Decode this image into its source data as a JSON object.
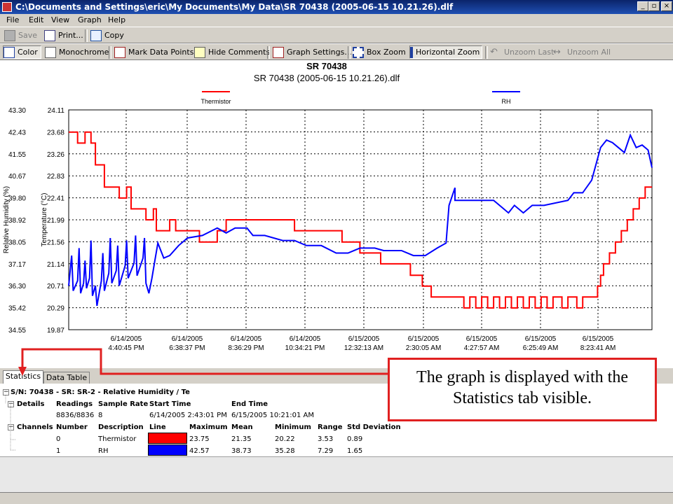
{
  "window": {
    "title": "C:\\Documents and Settings\\eric\\My Documents\\My Data\\SR 70438 (2005-06-15 10.21.26).dlf",
    "btn_min": "_",
    "btn_max": "▫",
    "btn_close": "×"
  },
  "menu": {
    "file": "File",
    "edit": "Edit",
    "view": "View",
    "graph": "Graph",
    "help": "Help"
  },
  "toolbar1": {
    "save": "Save",
    "print": "Print...",
    "copy": "Copy"
  },
  "toolbar2": {
    "color": "Color",
    "monochrome": "Monochrome",
    "mark_points": "Mark Data Points",
    "hide_comments": "Hide Comments",
    "graph_settings": "Graph Settings...",
    "box_zoom": "Box Zoom",
    "horizontal_zoom": "Horizontal Zoom",
    "unzoom_last": "Unzoom Last",
    "unzoom_all": "Unzoom All"
  },
  "tabs": {
    "statistics": "Statistics",
    "data_table": "Data Table"
  },
  "stats": {
    "tree_header": "S/N: 70438 - SR: SR-2 - Relative Humidity / Te",
    "details": {
      "label": "Details",
      "readings_h": "Readings",
      "sample_rate_h": "Sample Rate",
      "start_time_h": "Start Time",
      "end_time_h": "End Time",
      "readings": "8836/8836",
      "sample_rate": "8",
      "start_time": "6/14/2005 2:43:01 PM",
      "end_time": "6/15/2005 10:21:01 AM"
    },
    "channels": {
      "label": "Channels",
      "number_h": "Number",
      "description_h": "Description",
      "line_h": "Line",
      "maximum_h": "Maximum",
      "mean_h": "Mean",
      "minimum_h": "Minimum",
      "range_h": "Range",
      "std_h": "Std Deviation",
      "rows": [
        {
          "number": "0",
          "description": "Thermistor",
          "color": "#ff0000",
          "maximum": "23.75",
          "mean": "21.35",
          "minimum": "20.22",
          "range": "3.53",
          "std": "0.89"
        },
        {
          "number": "1",
          "description": "RH",
          "color": "#0000ff",
          "maximum": "42.57",
          "mean": "38.73",
          "minimum": "35.28",
          "range": "7.29",
          "std": "1.65"
        }
      ]
    }
  },
  "callout": {
    "text": "The graph is displayed with the Statistics tab visible."
  },
  "chart_data": {
    "type": "line",
    "title": "SR 70438",
    "subtitle": "SR 70438 (2005-06-15 10.21.26).dlf",
    "ylabel_left": "Relative Humidity (%)",
    "ylabel_right": "Temperature (°C)",
    "rh_ticks": [
      "43.30",
      "42.43",
      "41.55",
      "40.67",
      "39.80",
      "38.92",
      "38.05",
      "37.17",
      "36.30",
      "35.42",
      "34.55"
    ],
    "temp_ticks": [
      "24.11",
      "23.68",
      "23.26",
      "22.83",
      "22.41",
      "21.99",
      "21.56",
      "21.14",
      "20.71",
      "20.29",
      "19.87"
    ],
    "x_ticks": [
      [
        "6/14/2005",
        "4:40:45 PM"
      ],
      [
        "6/14/2005",
        "6:38:37 PM"
      ],
      [
        "6/14/2005",
        "8:36:29 PM"
      ],
      [
        "6/14/2005",
        "10:34:21 PM"
      ],
      [
        "6/15/2005",
        "12:32:13 AM"
      ],
      [
        "6/15/2005",
        "2:30:05 AM"
      ],
      [
        "6/15/2005",
        "4:27:57 AM"
      ],
      [
        "6/15/2005",
        "6:25:49 AM"
      ],
      [
        "6/15/2005",
        "8:23:41 AM"
      ]
    ],
    "rh_ylim": [
      34.55,
      43.3
    ],
    "temp_ylim": [
      19.87,
      24.11
    ],
    "x_hours_range": [
      0,
      19.63
    ],
    "grid": true,
    "legend_position": "top",
    "series": [
      {
        "name": "Thermistor",
        "axis": "temp",
        "color": "#ff0000",
        "points": [
          [
            0,
            23.68
          ],
          [
            0.3,
            23.68
          ],
          [
            0.3,
            23.47
          ],
          [
            0.55,
            23.47
          ],
          [
            0.55,
            23.68
          ],
          [
            0.75,
            23.68
          ],
          [
            0.75,
            23.47
          ],
          [
            0.9,
            23.47
          ],
          [
            0.9,
            23.05
          ],
          [
            1.2,
            23.05
          ],
          [
            1.2,
            22.62
          ],
          [
            1.7,
            22.62
          ],
          [
            1.7,
            22.41
          ],
          [
            1.95,
            22.41
          ],
          [
            1.95,
            22.62
          ],
          [
            2.1,
            22.62
          ],
          [
            2.1,
            22.2
          ],
          [
            2.6,
            22.2
          ],
          [
            2.6,
            21.99
          ],
          [
            2.85,
            21.99
          ],
          [
            2.85,
            22.2
          ],
          [
            2.95,
            22.2
          ],
          [
            2.95,
            21.78
          ],
          [
            3.4,
            21.78
          ],
          [
            3.4,
            21.99
          ],
          [
            3.6,
            21.99
          ],
          [
            3.6,
            21.78
          ],
          [
            4.4,
            21.78
          ],
          [
            4.4,
            21.56
          ],
          [
            5.0,
            21.56
          ],
          [
            5.0,
            21.78
          ],
          [
            5.3,
            21.78
          ],
          [
            5.3,
            21.99
          ],
          [
            7.6,
            21.99
          ],
          [
            7.6,
            21.78
          ],
          [
            9.2,
            21.78
          ],
          [
            9.2,
            21.56
          ],
          [
            9.8,
            21.56
          ],
          [
            9.8,
            21.35
          ],
          [
            10.5,
            21.35
          ],
          [
            10.5,
            21.14
          ],
          [
            11.5,
            21.14
          ],
          [
            11.5,
            20.92
          ],
          [
            11.9,
            20.92
          ],
          [
            11.9,
            20.71
          ],
          [
            12.2,
            20.71
          ],
          [
            12.2,
            20.5
          ],
          [
            13.3,
            20.5
          ],
          [
            13.3,
            20.29
          ],
          [
            13.5,
            20.29
          ],
          [
            13.5,
            20.5
          ],
          [
            13.7,
            20.5
          ],
          [
            13.7,
            20.29
          ],
          [
            13.9,
            20.29
          ],
          [
            13.9,
            20.5
          ],
          [
            14.1,
            20.5
          ],
          [
            14.1,
            20.29
          ],
          [
            14.3,
            20.29
          ],
          [
            14.3,
            20.5
          ],
          [
            14.5,
            20.5
          ],
          [
            14.5,
            20.29
          ],
          [
            14.7,
            20.29
          ],
          [
            14.7,
            20.5
          ],
          [
            14.9,
            20.5
          ],
          [
            14.9,
            20.29
          ],
          [
            15.1,
            20.29
          ],
          [
            15.1,
            20.5
          ],
          [
            15.3,
            20.5
          ],
          [
            15.3,
            20.29
          ],
          [
            15.5,
            20.29
          ],
          [
            15.5,
            20.5
          ],
          [
            15.7,
            20.5
          ],
          [
            15.7,
            20.29
          ],
          [
            15.9,
            20.29
          ],
          [
            15.9,
            20.5
          ],
          [
            16.1,
            20.5
          ],
          [
            16.1,
            20.29
          ],
          [
            16.3,
            20.29
          ],
          [
            16.3,
            20.5
          ],
          [
            16.6,
            20.5
          ],
          [
            16.6,
            20.29
          ],
          [
            16.8,
            20.29
          ],
          [
            16.8,
            20.5
          ],
          [
            17.1,
            20.5
          ],
          [
            17.1,
            20.29
          ],
          [
            17.3,
            20.29
          ],
          [
            17.3,
            20.5
          ],
          [
            17.8,
            20.5
          ],
          [
            17.8,
            20.71
          ],
          [
            17.9,
            20.71
          ],
          [
            17.9,
            20.92
          ],
          [
            18.0,
            20.92
          ],
          [
            18.0,
            21.14
          ],
          [
            18.2,
            21.14
          ],
          [
            18.2,
            21.35
          ],
          [
            18.4,
            21.35
          ],
          [
            18.4,
            21.56
          ],
          [
            18.6,
            21.56
          ],
          [
            18.6,
            21.78
          ],
          [
            18.8,
            21.78
          ],
          [
            18.8,
            21.99
          ],
          [
            19.0,
            21.99
          ],
          [
            19.0,
            22.2
          ],
          [
            19.2,
            22.2
          ],
          [
            19.2,
            22.41
          ],
          [
            19.4,
            22.41
          ],
          [
            19.4,
            22.62
          ],
          [
            19.63,
            22.62
          ]
        ]
      },
      {
        "name": "RH",
        "axis": "rh",
        "color": "#0000ff",
        "points": [
          [
            0,
            36.3
          ],
          [
            0.1,
            37.5
          ],
          [
            0.15,
            36.1
          ],
          [
            0.3,
            36.5
          ],
          [
            0.35,
            37.8
          ],
          [
            0.4,
            36.0
          ],
          [
            0.5,
            36.4
          ],
          [
            0.55,
            37.3
          ],
          [
            0.6,
            36.2
          ],
          [
            0.7,
            36.6
          ],
          [
            0.75,
            38.1
          ],
          [
            0.8,
            35.9
          ],
          [
            0.9,
            36.3
          ],
          [
            0.95,
            35.5
          ],
          [
            1.1,
            36.5
          ],
          [
            1.15,
            37.6
          ],
          [
            1.2,
            36.1
          ],
          [
            1.35,
            36.8
          ],
          [
            1.4,
            38.2
          ],
          [
            1.45,
            36.4
          ],
          [
            1.6,
            36.9
          ],
          [
            1.65,
            37.9
          ],
          [
            1.7,
            36.3
          ],
          [
            1.9,
            37.1
          ],
          [
            1.95,
            38.1
          ],
          [
            2.0,
            36.6
          ],
          [
            2.2,
            37.2
          ],
          [
            2.25,
            38.3
          ],
          [
            2.3,
            36.7
          ],
          [
            2.5,
            37.4
          ],
          [
            2.55,
            38.2
          ],
          [
            2.6,
            36.4
          ],
          [
            2.7,
            36.0
          ],
          [
            2.8,
            36.6
          ],
          [
            2.9,
            37.3
          ],
          [
            3.0,
            38.0
          ],
          [
            3.2,
            37.4
          ],
          [
            3.4,
            37.5
          ],
          [
            3.7,
            37.9
          ],
          [
            4.0,
            38.2
          ],
          [
            4.5,
            38.3
          ],
          [
            5.0,
            38.6
          ],
          [
            5.3,
            38.4
          ],
          [
            5.6,
            38.6
          ],
          [
            6.0,
            38.6
          ],
          [
            6.2,
            38.3
          ],
          [
            6.6,
            38.3
          ],
          [
            7.2,
            38.1
          ],
          [
            7.6,
            38.1
          ],
          [
            8.0,
            37.9
          ],
          [
            8.5,
            37.9
          ],
          [
            9.0,
            37.6
          ],
          [
            9.4,
            37.6
          ],
          [
            9.8,
            37.8
          ],
          [
            10.3,
            37.8
          ],
          [
            10.6,
            37.7
          ],
          [
            11.2,
            37.7
          ],
          [
            11.6,
            37.5
          ],
          [
            12.0,
            37.5
          ],
          [
            12.4,
            37.8
          ],
          [
            12.7,
            38.0
          ],
          [
            12.8,
            39.5
          ],
          [
            13.0,
            40.2
          ],
          [
            13.0,
            39.7
          ],
          [
            13.4,
            39.7
          ],
          [
            13.6,
            39.7
          ],
          [
            14.3,
            39.7
          ],
          [
            14.5,
            39.5
          ],
          [
            14.8,
            39.2
          ],
          [
            15.0,
            39.5
          ],
          [
            15.3,
            39.2
          ],
          [
            15.6,
            39.5
          ],
          [
            16.0,
            39.5
          ],
          [
            16.8,
            39.7
          ],
          [
            17.0,
            40.0
          ],
          [
            17.3,
            40.0
          ],
          [
            17.6,
            40.5
          ],
          [
            17.9,
            41.8
          ],
          [
            18.1,
            42.1
          ],
          [
            18.3,
            42.0
          ],
          [
            18.5,
            41.8
          ],
          [
            18.7,
            41.6
          ],
          [
            18.9,
            42.3
          ],
          [
            19.1,
            41.8
          ],
          [
            19.3,
            41.9
          ],
          [
            19.5,
            41.7
          ],
          [
            19.63,
            41.0
          ]
        ]
      }
    ]
  }
}
